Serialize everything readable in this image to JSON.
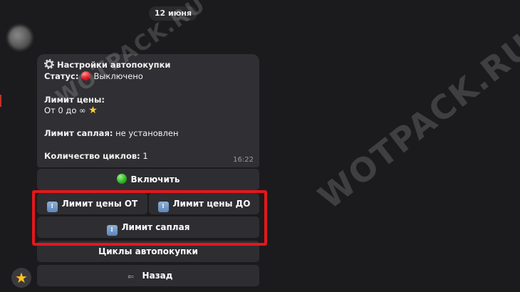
{
  "date_badge": "12 июня",
  "sender_name": "",
  "message": {
    "title": "Настройки автопокупки",
    "status_label": "Статус:",
    "status_value": "Выключено",
    "price_limit_label": "Лимит цены:",
    "price_limit_value": "От 0 до ∞",
    "sapling_limit_label": "Лимит саплая:",
    "sapling_limit_value": "не установлен",
    "cycles_label": "Количество циклов:",
    "cycles_value": "1",
    "time": "16:22"
  },
  "keyboard": {
    "enable": "Включить",
    "price_from": "Лимит цены ОТ",
    "price_to": "Лимит цены ДО",
    "supply_limit": "Лимит саплая",
    "autobuy_cycles": "Циклы автопокупки",
    "back": "Назад"
  },
  "icons": {
    "settings": "gear-icon",
    "status": "red-circle-icon",
    "price_limit": "star-icon",
    "enable": "green-circle-icon",
    "number_buttons": "numbers-keycap-icon",
    "back": "back-arrow-icon",
    "bot_avatar": "star-icon"
  },
  "colors": {
    "background": "#1b1b1d",
    "bubble": "#303034",
    "button": "#2e2e32",
    "highlight": "#e3171d"
  },
  "watermarks": [
    "WOTPACK.RU",
    "WOTPACK.RU"
  ]
}
